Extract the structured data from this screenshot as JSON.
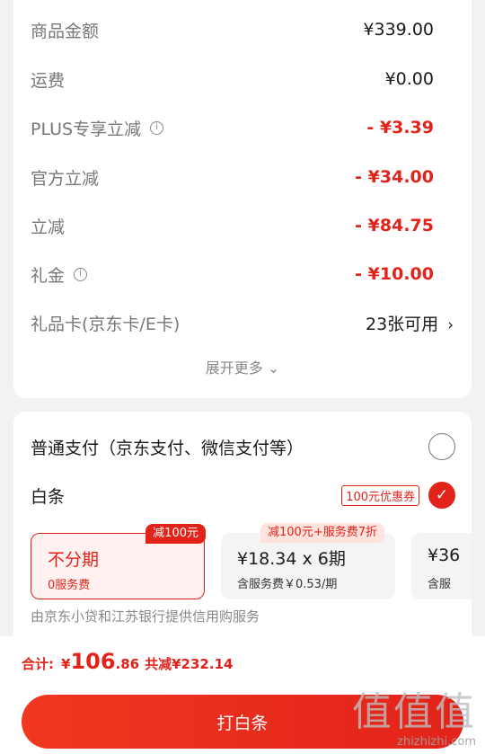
{
  "summary": {
    "rows": [
      {
        "label": "商品金额",
        "value": "¥339.00"
      },
      {
        "label": "运费",
        "value": "¥0.00"
      },
      {
        "label": "PLUS专享立减",
        "value": "- ¥3.39"
      },
      {
        "label": "官方立减",
        "value": "- ¥34.00"
      },
      {
        "label": "立减",
        "value": "- ¥84.75"
      },
      {
        "label": "礼金",
        "value": "- ¥10.00"
      },
      {
        "label": "礼品卡(京东卡/E卡)",
        "value": "23张可用"
      }
    ],
    "expand_more": "展开更多 ⌄"
  },
  "payment": {
    "option_normal": "普通支付（京东支付、微信支付等）",
    "option_baitiao": "白条",
    "coupon_badge": "100元优惠券",
    "installments": [
      {
        "title": "不分期",
        "sub": "0服务费",
        "tag": "减100元"
      },
      {
        "title": "¥18.34 x 6期",
        "sub": "含服务费￥0.53/期",
        "tag": "减100元+服务费7折"
      },
      {
        "title": "¥36",
        "sub": "含服"
      }
    ],
    "service_note": "由京东小贷和江苏银行提供信用购服务"
  },
  "footer": {
    "total_label": "合计:",
    "currency": "¥",
    "total_int": "106",
    "total_dec": ".86",
    "saved": "共减¥232.14",
    "pay_button": "打白条"
  },
  "watermark": {
    "big": "值值值",
    "small": "zhizhizhi.com"
  },
  "colors": {
    "accent": "#e2231a",
    "background": "#f2f2f2"
  }
}
